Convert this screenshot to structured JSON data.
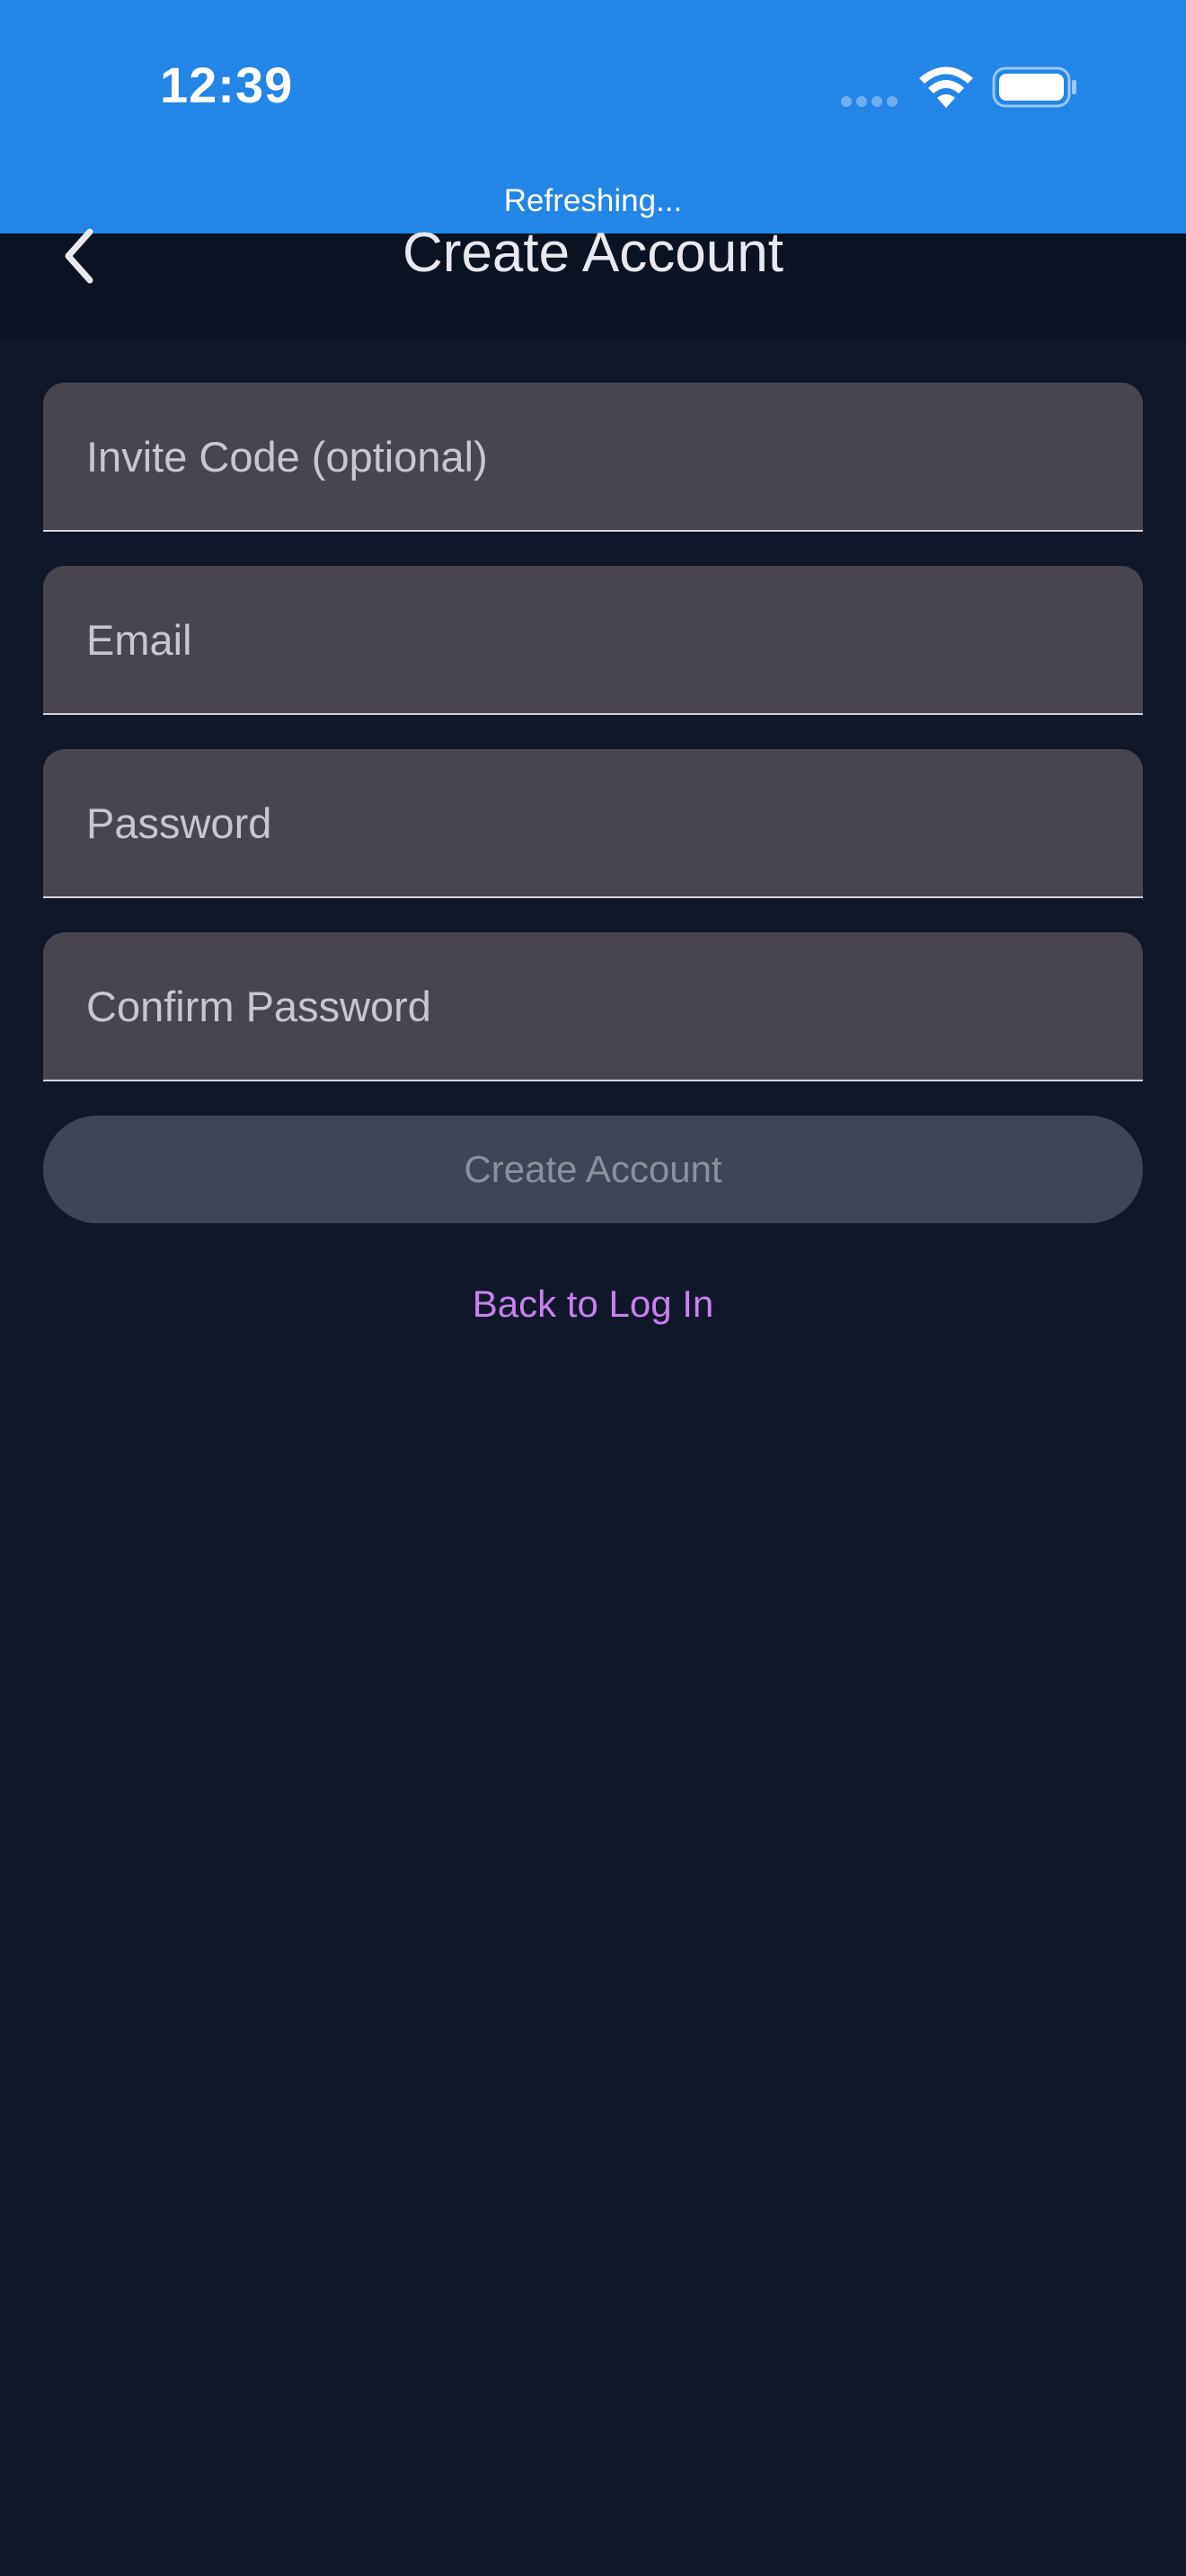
{
  "status_bar": {
    "time": "12:39",
    "refresh_text": "Refreshing...",
    "color": "#2385e6"
  },
  "header": {
    "title": "Create Account",
    "back_icon": "chevron-left-icon"
  },
  "form": {
    "invite_code": {
      "placeholder": "Invite Code (optional)",
      "value": ""
    },
    "email": {
      "placeholder": "Email",
      "value": ""
    },
    "password": {
      "placeholder": "Password",
      "value": ""
    },
    "confirm_password": {
      "placeholder": "Confirm Password",
      "value": ""
    },
    "submit_label": "Create Account",
    "submit_state": "disabled"
  },
  "links": {
    "back_to_login": "Back to Log In",
    "color": "#c782ec"
  },
  "theme": {
    "background": "#101729",
    "field_background": "#48454f"
  }
}
